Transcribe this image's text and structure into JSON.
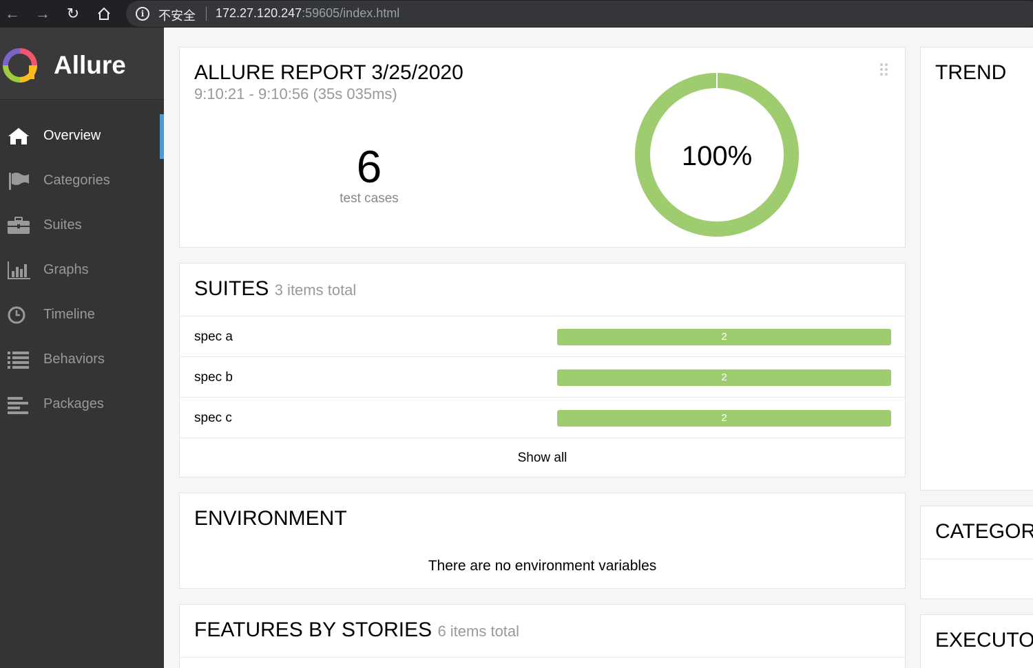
{
  "browser": {
    "security_label": "不安全",
    "url_host": "172.27.120.247",
    "url_rest": ":59605/index.html"
  },
  "sidebar": {
    "logo_text": "Allure",
    "items": [
      {
        "label": "Overview",
        "icon": "home-icon",
        "active": true
      },
      {
        "label": "Categories",
        "icon": "flag-icon",
        "active": false
      },
      {
        "label": "Suites",
        "icon": "briefcase-icon",
        "active": false
      },
      {
        "label": "Graphs",
        "icon": "bar-chart-icon",
        "active": false
      },
      {
        "label": "Timeline",
        "icon": "clock-icon",
        "active": false
      },
      {
        "label": "Behaviors",
        "icon": "list-icon",
        "active": false
      },
      {
        "label": "Packages",
        "icon": "align-left-icon",
        "active": false
      }
    ]
  },
  "summary": {
    "title": "ALLURE REPORT 3/25/2020",
    "datetime": "9:10:21 - 9:10:56 (35s 035ms)",
    "test_count": "6",
    "test_count_label": "test cases",
    "percent": "100%",
    "pass_fraction": 1.0,
    "pass_color": "#9fcc6e"
  },
  "suites": {
    "title": "SUITES",
    "subtitle": "3 items total",
    "rows": [
      {
        "name": "spec a",
        "count": "2"
      },
      {
        "name": "spec b",
        "count": "2"
      },
      {
        "name": "spec c",
        "count": "2"
      }
    ],
    "show_all": "Show all"
  },
  "environment": {
    "title": "ENVIRONMENT",
    "message": "There are no environment variables"
  },
  "features": {
    "title": "FEATURES BY STORIES",
    "subtitle": "6 items total"
  },
  "trend": {
    "title": "TREND"
  },
  "categories": {
    "title": "CATEGORIES"
  },
  "executors": {
    "title": "EXECUTORS"
  },
  "colors": {
    "sidebar_bg": "#343434",
    "accent": "#4b9cd6",
    "passed": "#9fcc6e"
  }
}
